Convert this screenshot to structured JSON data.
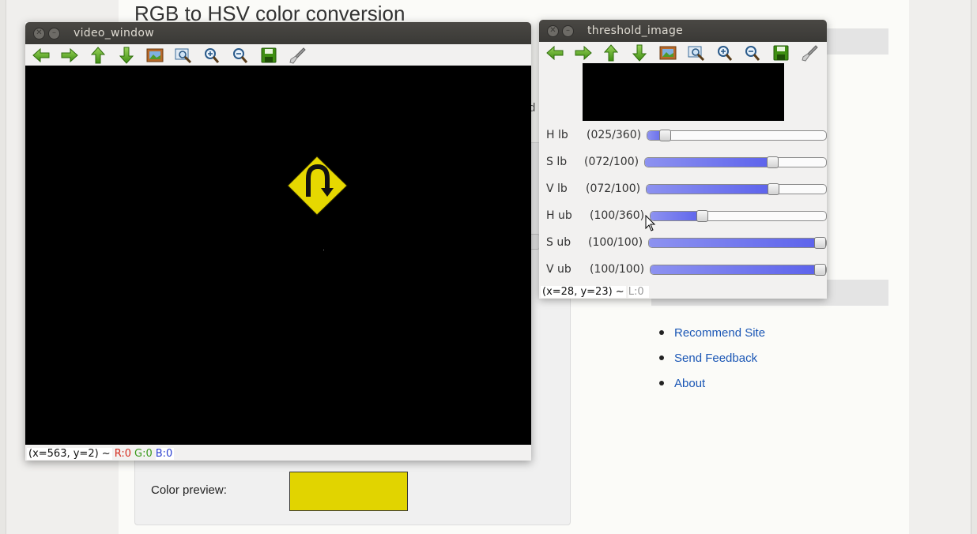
{
  "background_page": {
    "title": "RGB to HSV color conversion",
    "color_preview_label": "Color preview:",
    "color_preview_value": "#e1d400",
    "stray_text": "d",
    "sidebar_links": [
      "Recommend Site",
      "Send Feedback",
      "About"
    ]
  },
  "toolbar_icons": [
    "arrow-left-icon",
    "arrow-right-icon",
    "arrow-up-icon",
    "arrow-down-icon",
    "image-icon",
    "zoom-fit-icon",
    "zoom-in-icon",
    "zoom-out-icon",
    "save-icon",
    "brush-icon"
  ],
  "video_window": {
    "title": "video_window",
    "status": {
      "coords": "(x=563, y=2) ~",
      "r": "R:0",
      "g": "G:0",
      "b": "B:0"
    }
  },
  "threshold_window": {
    "title": "threshold_image",
    "status": {
      "coords": "(x=28, y=23) ~",
      "l": "L:0"
    },
    "sliders": [
      {
        "name": "H lb",
        "value": "(025/360)",
        "fraction": 0.069
      },
      {
        "name": "S lb",
        "value": "(072/100)",
        "fraction": 0.72
      },
      {
        "name": "V lb",
        "value": "(072/100)",
        "fraction": 0.72
      },
      {
        "name": "H ub",
        "value": "(100/360)",
        "fraction": 0.278
      },
      {
        "name": "S ub",
        "value": "(100/100)",
        "fraction": 1.0
      },
      {
        "name": "V ub",
        "value": "(100/100)",
        "fraction": 1.0
      }
    ]
  },
  "colors": {
    "fill_start": "#8d92f0",
    "fill_end": "#5c62ec",
    "sign_yellow": "#e6d800",
    "status_r": "#d62d20",
    "status_g": "#3a9a1c",
    "status_b": "#2b3fd0"
  }
}
